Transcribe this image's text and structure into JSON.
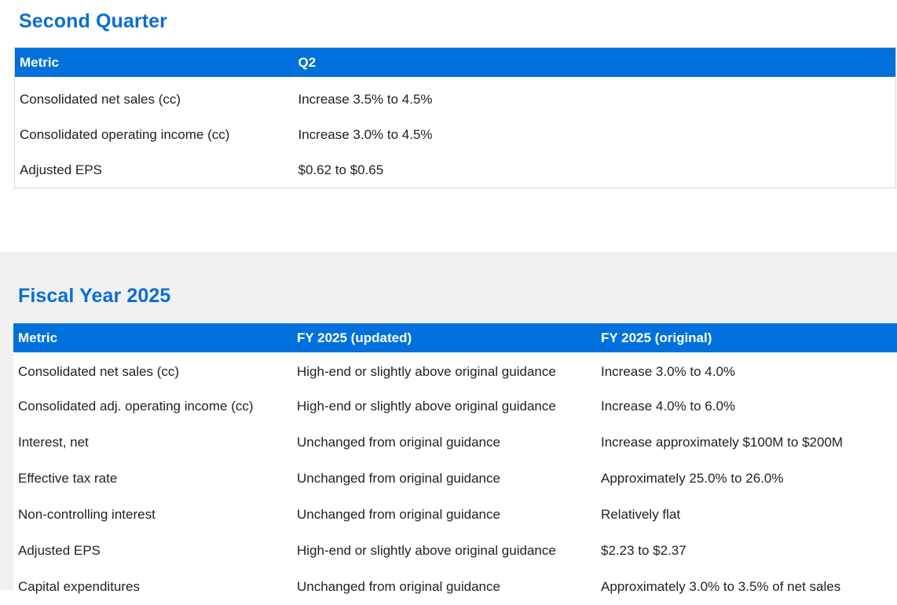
{
  "second_quarter": {
    "heading": "Second Quarter",
    "columns": [
      "Metric",
      "Q2"
    ],
    "rows": [
      [
        "Consolidated net sales (cc)",
        "Increase 3.5% to 4.5%"
      ],
      [
        "Consolidated operating income (cc)",
        "Increase 3.0% to 4.5%"
      ],
      [
        "Adjusted EPS",
        "$0.62 to $0.65"
      ]
    ]
  },
  "fiscal_year": {
    "heading": "Fiscal Year 2025",
    "columns": [
      "Metric",
      "FY 2025 (updated)",
      "FY 2025 (original)"
    ],
    "rows": [
      [
        "Consolidated net sales (cc)",
        "High-end or slightly above original guidance",
        "Increase 3.0% to 4.0%"
      ],
      [
        "Consolidated adj. operating income (cc)",
        "High-end or slightly above original guidance",
        "Increase 4.0% to 6.0%"
      ],
      [
        "Interest, net",
        "Unchanged from original guidance",
        "Increase approximately $100M to $200M"
      ],
      [
        "Effective tax rate",
        "Unchanged from original guidance",
        "Approximately 25.0% to 26.0%"
      ],
      [
        "Non-controlling interest",
        "Unchanged from original guidance",
        "Relatively flat"
      ],
      [
        "Adjusted EPS",
        "High-end or slightly above original guidance",
        "$2.23 to $2.37"
      ],
      [
        "Capital expenditures",
        "Unchanged from original guidance",
        "Approximately 3.0% to 3.5% of net sales"
      ]
    ]
  },
  "colors": {
    "heading": "#0a6ed1",
    "header_bg": "#0071dc",
    "header_text": "#ffffff",
    "section_gray": "#f1f1f1"
  }
}
